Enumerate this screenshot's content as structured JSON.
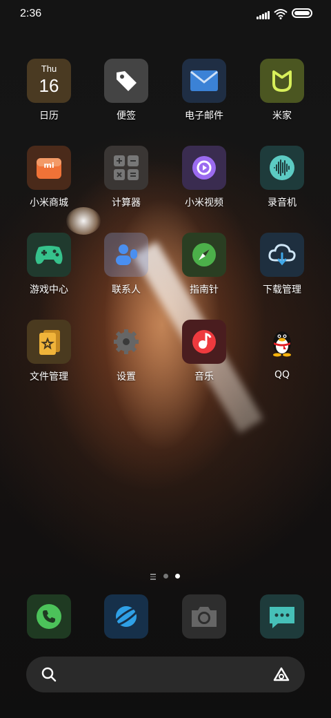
{
  "status_bar": {
    "time": "2:36"
  },
  "apps": [
    {
      "label": "日历",
      "icon": "calendar-icon",
      "calendar_day": "Thu",
      "calendar_date": "16"
    },
    {
      "label": "便签",
      "icon": "notes-tag-icon"
    },
    {
      "label": "电子邮件",
      "icon": "email-icon"
    },
    {
      "label": "米家",
      "icon": "mijia-icon"
    },
    {
      "label": "小米商城",
      "icon": "mi-store-icon",
      "badge_text": "mi"
    },
    {
      "label": "计算器",
      "icon": "calculator-icon"
    },
    {
      "label": "小米视频",
      "icon": "video-play-icon"
    },
    {
      "label": "录音机",
      "icon": "recorder-waveform-icon"
    },
    {
      "label": "游戏中心",
      "icon": "gamepad-icon"
    },
    {
      "label": "联系人",
      "icon": "contacts-icon"
    },
    {
      "label": "指南针",
      "icon": "compass-icon"
    },
    {
      "label": "下载管理",
      "icon": "download-cloud-icon"
    },
    {
      "label": "文件管理",
      "icon": "file-manager-icon"
    },
    {
      "label": "设置",
      "icon": "settings-gear-icon"
    },
    {
      "label": "音乐",
      "icon": "music-icon"
    },
    {
      "label": "QQ",
      "icon": "qq-penguin-icon"
    }
  ],
  "page_indicator": {
    "pages": 2,
    "current": 2
  },
  "dock": [
    {
      "icon": "phone-icon"
    },
    {
      "icon": "browser-icon"
    },
    {
      "icon": "camera-icon"
    },
    {
      "icon": "messages-icon"
    }
  ],
  "search_bar": {
    "left_icon": "search-icon",
    "right_icon": "assistant-icon"
  }
}
